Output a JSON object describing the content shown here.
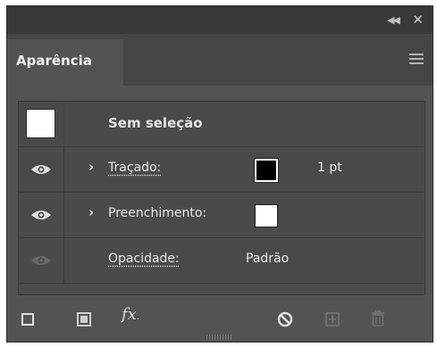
{
  "panel": {
    "tab_label": "Aparência",
    "icons": {
      "collapse": "double-chevron-left-icon",
      "close": "close-icon",
      "menu": "hamburger-menu-icon"
    }
  },
  "rows": {
    "selection": {
      "label": "Sem seleção"
    },
    "stroke": {
      "label": "Traçado:",
      "value": "1 pt",
      "swatch_color": "#000000"
    },
    "fill": {
      "label": "Preenchimento:",
      "swatch_color": "#ffffff"
    },
    "opacity": {
      "label": "Opacidade:",
      "value": "Padrão"
    }
  },
  "footer": {
    "fx_label": "fx",
    "icons": [
      "add-new-stroke-icon",
      "add-new-fill-icon",
      "add-new-effect-icon",
      "clear-appearance-icon",
      "duplicate-item-icon",
      "delete-item-icon"
    ]
  },
  "colors": {
    "panel_bg": "#535353",
    "title_bg": "#393939",
    "list_bg": "#4a4a4a"
  }
}
